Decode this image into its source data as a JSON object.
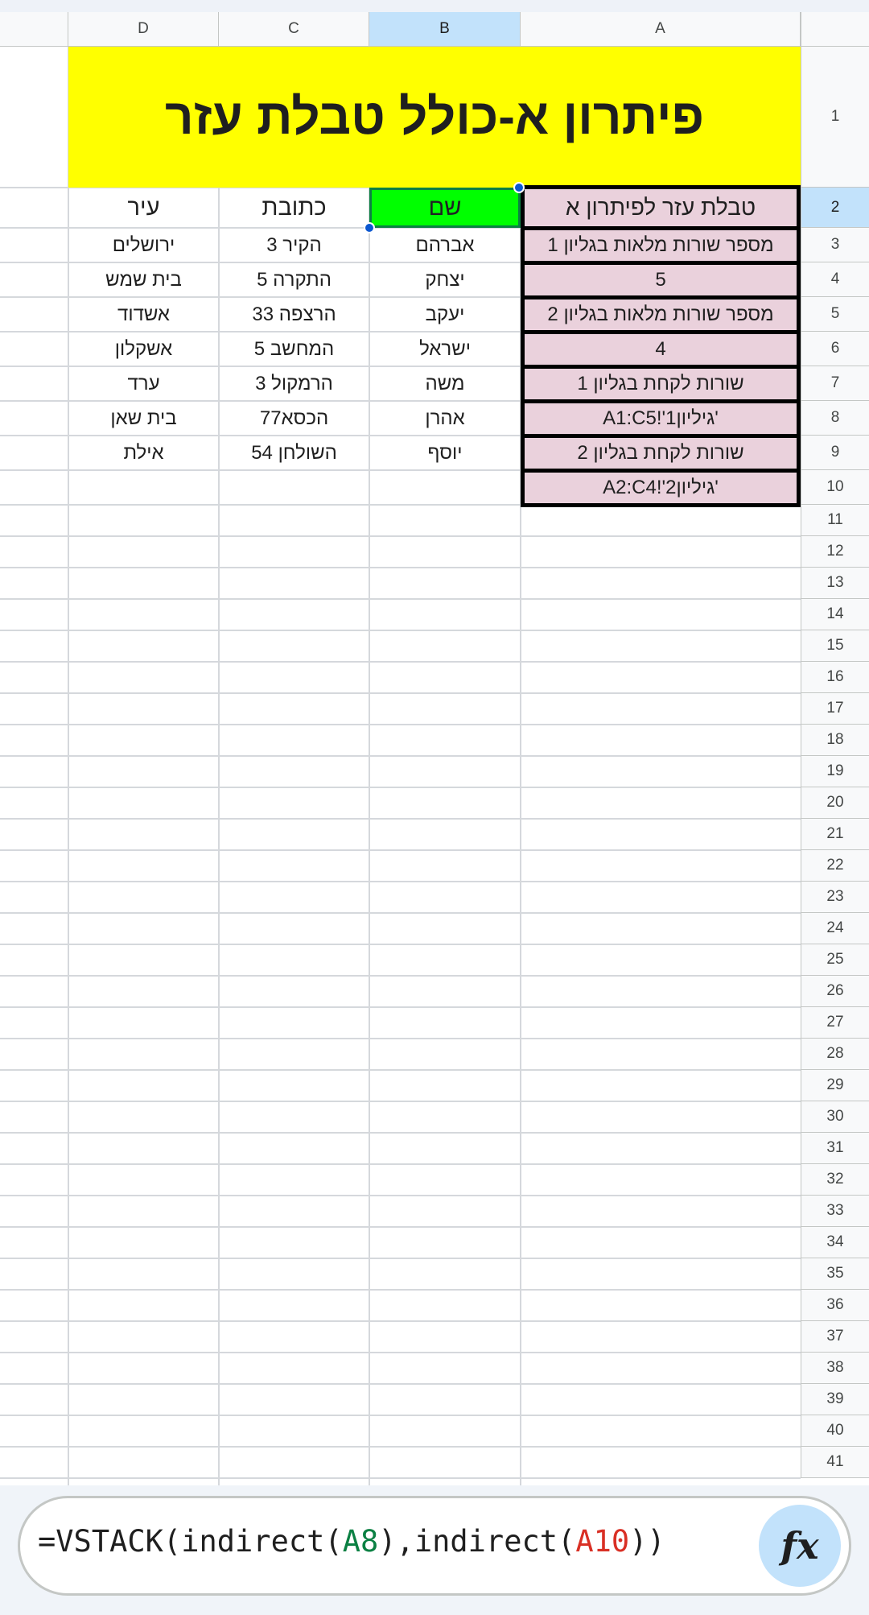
{
  "columns": [
    "D",
    "C",
    "B",
    "A"
  ],
  "selected_column": "B",
  "selected_row": "2",
  "rows": [
    "1",
    "2",
    "3",
    "4",
    "5",
    "6",
    "7",
    "8",
    "9",
    "10",
    "11",
    "12",
    "13",
    "14",
    "15",
    "16",
    "17",
    "18",
    "19",
    "20",
    "21",
    "22",
    "23",
    "24",
    "25",
    "26",
    "27",
    "28",
    "29",
    "30",
    "31",
    "32",
    "33",
    "34",
    "35",
    "36",
    "37",
    "38",
    "39",
    "40",
    "41"
  ],
  "title": "פיתרון א-כולל טבלת עזר",
  "header_row": {
    "name": "שם",
    "address": "כתובת",
    "city": "עיר"
  },
  "people": [
    {
      "name": "אברהם",
      "address": "הקיר 3",
      "city": "ירושלים"
    },
    {
      "name": "יצחק",
      "address": "התקרה 5",
      "city": "בית שמש"
    },
    {
      "name": "יעקב",
      "address": "הרצפה 33",
      "city": "אשדוד"
    },
    {
      "name": "ישראל",
      "address": "המחשב 5",
      "city": "אשקלון"
    },
    {
      "name": "משה",
      "address": "הרמקול 3",
      "city": "ערד"
    },
    {
      "name": "אהרן",
      "address": "הכסא77",
      "city": "בית שאן"
    },
    {
      "name": "יוסף",
      "address": "השולחן 54",
      "city": "אילת"
    }
  ],
  "helper_table": [
    "טבלת עזר לפיתרון א",
    "מספר שורות מלאות בגליון 1",
    "5",
    "מספר שורות מלאות בגליון 2",
    "4",
    "שורות לקחת בגליון 1",
    "'גיליון1'!A1:C5",
    "שורות לקחת בגליון 2",
    "'גיליון2'!A2:C4"
  ],
  "formula_bar": {
    "prefix": "=VSTACK(indirect(",
    "ref1": "A8",
    "middle": "),indirect(",
    "ref2": "A10",
    "suffix": "))",
    "fx_label": "fx"
  },
  "colors": {
    "title_bg": "#ffff00",
    "selected_cell_bg": "#00ff00",
    "helper_bg": "#ead1dc",
    "header_selected_bg": "#c2e2fb",
    "ref1_color": "#0b8043",
    "ref2_color": "#d93025"
  }
}
